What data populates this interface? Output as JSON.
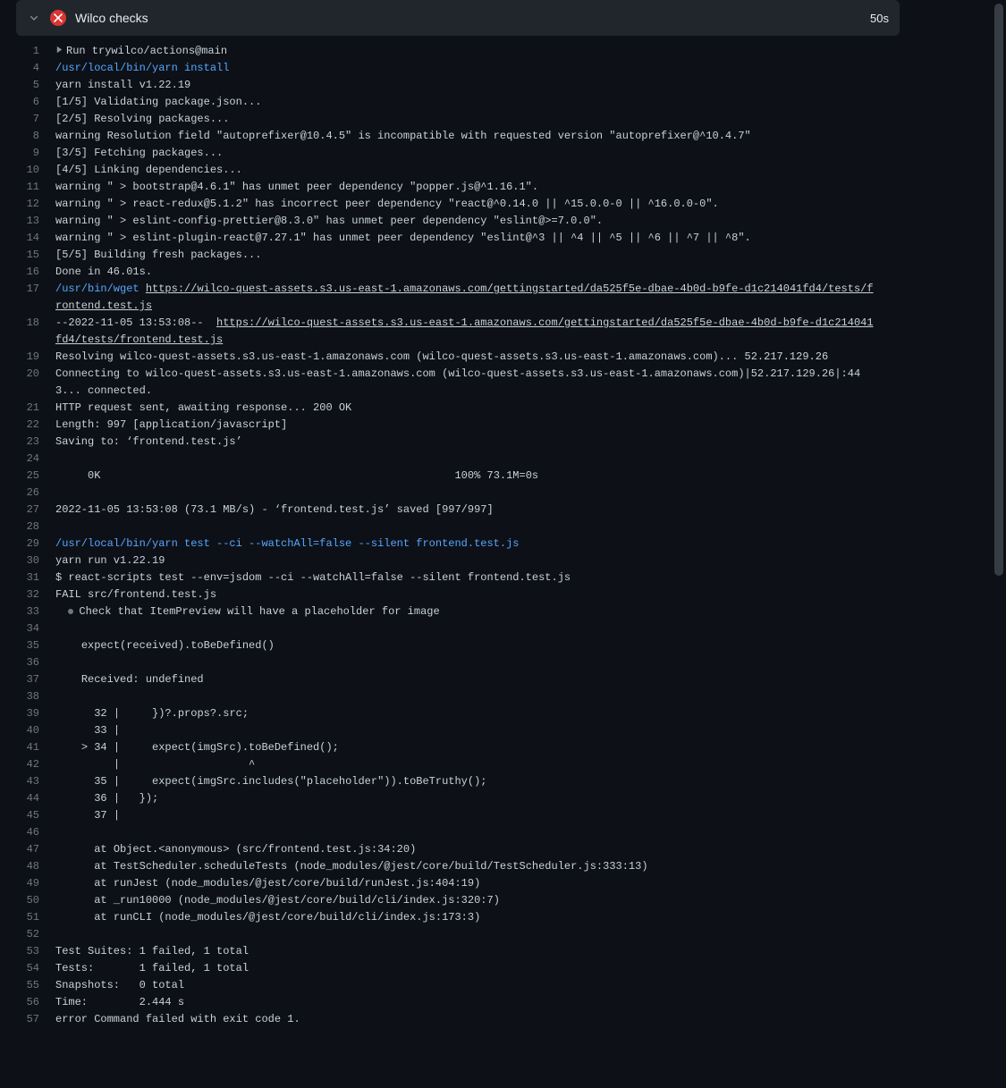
{
  "header": {
    "title": "Wilco checks",
    "duration": "50s",
    "status": "failed"
  },
  "lines": [
    {
      "n": 1,
      "type": "run",
      "text": "Run trywilco/actions@main"
    },
    {
      "n": 4,
      "type": "cmd",
      "text": "/usr/local/bin/yarn install"
    },
    {
      "n": 5,
      "type": "plain",
      "text": "yarn install v1.22.19"
    },
    {
      "n": 6,
      "type": "plain",
      "text": "[1/5] Validating package.json..."
    },
    {
      "n": 7,
      "type": "plain",
      "text": "[2/5] Resolving packages..."
    },
    {
      "n": 8,
      "type": "plain",
      "text": "warning Resolution field \"autoprefixer@10.4.5\" is incompatible with requested version \"autoprefixer@^10.4.7\""
    },
    {
      "n": 9,
      "type": "plain",
      "text": "[3/5] Fetching packages..."
    },
    {
      "n": 10,
      "type": "plain",
      "text": "[4/5] Linking dependencies..."
    },
    {
      "n": 11,
      "type": "plain",
      "text": "warning \" > bootstrap@4.6.1\" has unmet peer dependency \"popper.js@^1.16.1\"."
    },
    {
      "n": 12,
      "type": "plain",
      "text": "warning \" > react-redux@5.1.2\" has incorrect peer dependency \"react@^0.14.0 || ^15.0.0-0 || ^16.0.0-0\"."
    },
    {
      "n": 13,
      "type": "plain",
      "text": "warning \" > eslint-config-prettier@8.3.0\" has unmet peer dependency \"eslint@>=7.0.0\"."
    },
    {
      "n": 14,
      "type": "plain",
      "text": "warning \" > eslint-plugin-react@7.27.1\" has unmet peer dependency \"eslint@^3 || ^4 || ^5 || ^6 || ^7 || ^8\"."
    },
    {
      "n": 15,
      "type": "plain",
      "text": "[5/5] Building fresh packages..."
    },
    {
      "n": 16,
      "type": "plain",
      "text": "Done in 46.01s."
    },
    {
      "n": 17,
      "type": "cmdurl",
      "cmd": "/usr/bin/wget ",
      "url": "https://wilco-quest-assets.s3.us-east-1.amazonaws.com/gettingstarted/da525f5e-dbae-4b0d-b9fe-d1c214041fd4/tests/frontend.test.js"
    },
    {
      "n": 18,
      "type": "plainurl",
      "pre": "--2022-11-05 13:53:08--  ",
      "url": "https://wilco-quest-assets.s3.us-east-1.amazonaws.com/gettingstarted/da525f5e-dbae-4b0d-b9fe-d1c214041fd4/tests/frontend.test.js"
    },
    {
      "n": 19,
      "type": "plain",
      "text": "Resolving wilco-quest-assets.s3.us-east-1.amazonaws.com (wilco-quest-assets.s3.us-east-1.amazonaws.com)... 52.217.129.26"
    },
    {
      "n": 20,
      "type": "plain",
      "text": "Connecting to wilco-quest-assets.s3.us-east-1.amazonaws.com (wilco-quest-assets.s3.us-east-1.amazonaws.com)|52.217.129.26|:443... connected."
    },
    {
      "n": 21,
      "type": "plain",
      "text": "HTTP request sent, awaiting response... 200 OK"
    },
    {
      "n": 22,
      "type": "plain",
      "text": "Length: 997 [application/javascript]"
    },
    {
      "n": 23,
      "type": "plain",
      "text": "Saving to: ‘frontend.test.js’"
    },
    {
      "n": 24,
      "type": "plain",
      "text": ""
    },
    {
      "n": 25,
      "type": "plain",
      "text": "     0K                                                       100% 73.1M=0s"
    },
    {
      "n": 26,
      "type": "plain",
      "text": ""
    },
    {
      "n": 27,
      "type": "plain",
      "text": "2022-11-05 13:53:08 (73.1 MB/s) - ‘frontend.test.js’ saved [997/997]"
    },
    {
      "n": 28,
      "type": "plain",
      "text": ""
    },
    {
      "n": 29,
      "type": "cmd",
      "text": "/usr/local/bin/yarn test --ci --watchAll=false --silent frontend.test.js"
    },
    {
      "n": 30,
      "type": "plain",
      "text": "yarn run v1.22.19"
    },
    {
      "n": 31,
      "type": "plain",
      "text": "$ react-scripts test --env=jsdom --ci --watchAll=false --silent frontend.test.js"
    },
    {
      "n": 32,
      "type": "plain",
      "text": "FAIL src/frontend.test.js"
    },
    {
      "n": 33,
      "type": "bullet",
      "text": "Check that ItemPreview will have a placeholder for image"
    },
    {
      "n": 34,
      "type": "plain",
      "text": ""
    },
    {
      "n": 35,
      "type": "plain",
      "text": "    expect(received).toBeDefined()"
    },
    {
      "n": 36,
      "type": "plain",
      "text": ""
    },
    {
      "n": 37,
      "type": "plain",
      "text": "    Received: undefined"
    },
    {
      "n": 38,
      "type": "plain",
      "text": ""
    },
    {
      "n": 39,
      "type": "plain",
      "text": "      32 |     })?.props?.src;"
    },
    {
      "n": 40,
      "type": "plain",
      "text": "      33 |"
    },
    {
      "n": 41,
      "type": "plain",
      "text": "    > 34 |     expect(imgSrc).toBeDefined();"
    },
    {
      "n": 42,
      "type": "plain",
      "text": "         |                    ^"
    },
    {
      "n": 43,
      "type": "plain",
      "text": "      35 |     expect(imgSrc.includes(\"placeholder\")).toBeTruthy();"
    },
    {
      "n": 44,
      "type": "plain",
      "text": "      36 |   });"
    },
    {
      "n": 45,
      "type": "plain",
      "text": "      37 |"
    },
    {
      "n": 46,
      "type": "plain",
      "text": ""
    },
    {
      "n": 47,
      "type": "plain",
      "text": "      at Object.<anonymous> (src/frontend.test.js:34:20)"
    },
    {
      "n": 48,
      "type": "plain",
      "text": "      at TestScheduler.scheduleTests (node_modules/@jest/core/build/TestScheduler.js:333:13)"
    },
    {
      "n": 49,
      "type": "plain",
      "text": "      at runJest (node_modules/@jest/core/build/runJest.js:404:19)"
    },
    {
      "n": 50,
      "type": "plain",
      "text": "      at _run10000 (node_modules/@jest/core/build/cli/index.js:320:7)"
    },
    {
      "n": 51,
      "type": "plain",
      "text": "      at runCLI (node_modules/@jest/core/build/cli/index.js:173:3)"
    },
    {
      "n": 52,
      "type": "plain",
      "text": ""
    },
    {
      "n": 53,
      "type": "plain",
      "text": "Test Suites: 1 failed, 1 total"
    },
    {
      "n": 54,
      "type": "plain",
      "text": "Tests:       1 failed, 1 total"
    },
    {
      "n": 55,
      "type": "plain",
      "text": "Snapshots:   0 total"
    },
    {
      "n": 56,
      "type": "plain",
      "text": "Time:        2.444 s"
    },
    {
      "n": 57,
      "type": "plain",
      "text": "error Command failed with exit code 1."
    }
  ]
}
